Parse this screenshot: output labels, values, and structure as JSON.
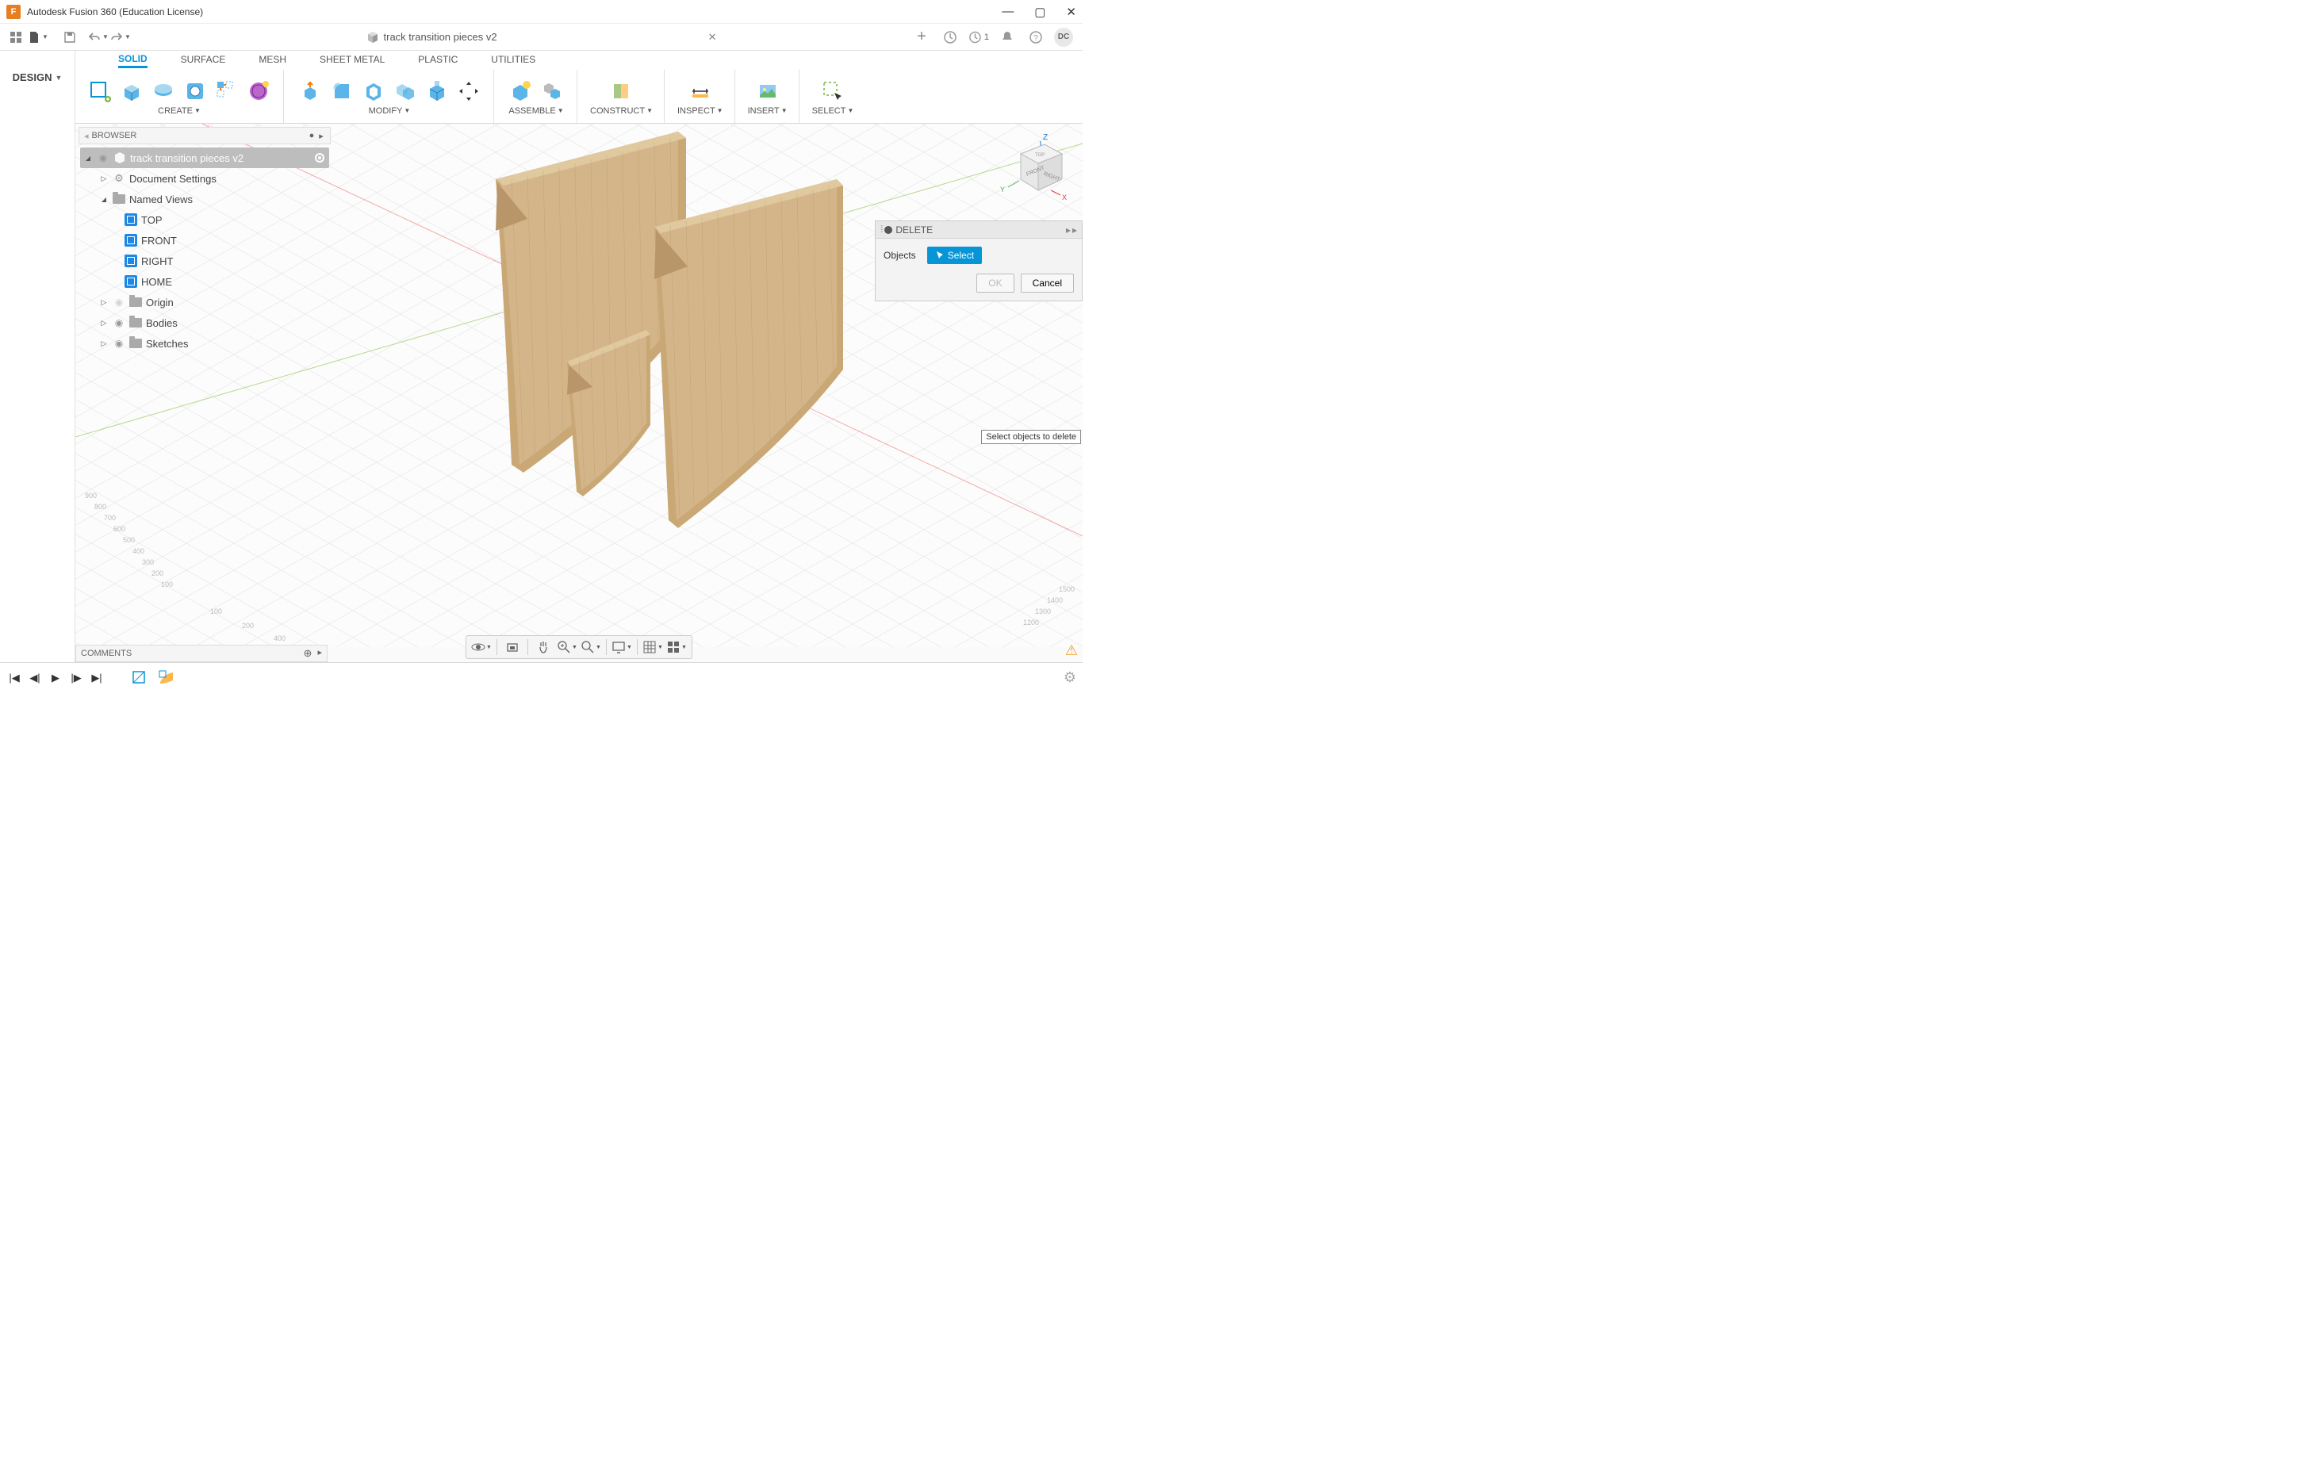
{
  "app": {
    "title": "Autodesk Fusion 360 (Education License)",
    "avatar": "DC",
    "job_count": "1"
  },
  "document": {
    "name": "track transition pieces v2"
  },
  "workspace": {
    "label": "DESIGN"
  },
  "ribbon_tabs": [
    "SOLID",
    "SURFACE",
    "MESH",
    "SHEET METAL",
    "PLASTIC",
    "UTILITIES"
  ],
  "ribbon_groups": {
    "create": "CREATE",
    "modify": "MODIFY",
    "assemble": "ASSEMBLE",
    "construct": "CONSTRUCT",
    "inspect": "INSPECT",
    "insert": "INSERT",
    "select": "SELECT"
  },
  "browser": {
    "title": "BROWSER",
    "root": "track transition pieces v2",
    "doc_settings": "Document Settings",
    "named_views": "Named Views",
    "views": [
      "TOP",
      "FRONT",
      "RIGHT",
      "HOME"
    ],
    "origin": "Origin",
    "bodies": "Bodies",
    "sketches": "Sketches"
  },
  "comments": {
    "title": "COMMENTS"
  },
  "delete_dialog": {
    "title": "DELETE",
    "objects_label": "Objects",
    "select_btn": "Select",
    "ok": "OK",
    "cancel": "Cancel"
  },
  "tooltip": "Select objects to delete",
  "viewcube": {
    "front": "FRONT",
    "right": "RIGHT",
    "top": "TOP"
  }
}
